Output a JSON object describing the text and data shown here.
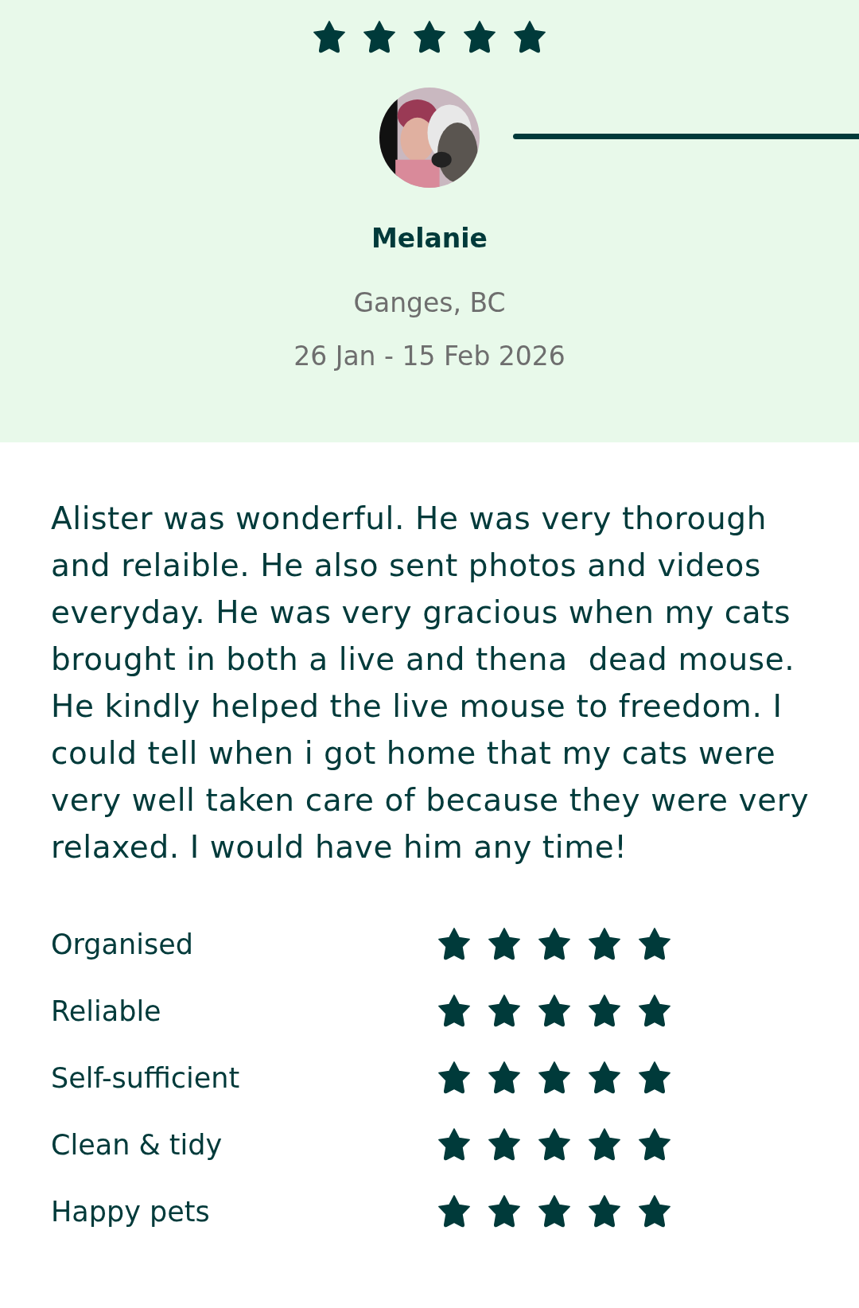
{
  "review": {
    "stars": 5,
    "reviewer": "Melanie",
    "location": "Ganges, BC",
    "dates": "26 Jan - 15 Feb 2026",
    "text": "Alister was wonderful. He was very thorough and relaible. He also sent photos and videos everyday. He was very gracious when my cats brought in both a live and thena  dead mouse. He kindly helped the live mouse to freedom. I could tell when i got home that my cats were very well taken care of because they were very relaxed. I would have him any time!"
  },
  "ratings": [
    {
      "label": "Organised",
      "stars": 5
    },
    {
      "label": "Reliable",
      "stars": 5
    },
    {
      "label": "Self-sufficient",
      "stars": 5
    },
    {
      "label": "Clean & tidy",
      "stars": 5
    },
    {
      "label": "Happy pets",
      "stars": 5
    }
  ]
}
